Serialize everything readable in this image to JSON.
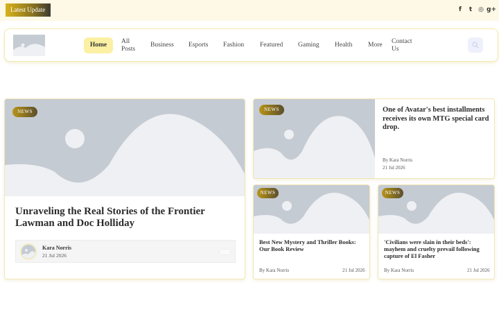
{
  "topbar": {
    "latest_label": "Latest Update",
    "social": [
      {
        "name": "facebook-icon",
        "glyph": "f"
      },
      {
        "name": "twitter-icon",
        "glyph": "t"
      },
      {
        "name": "instagram-icon",
        "glyph": "◎"
      },
      {
        "name": "google-plus-icon",
        "glyph": "g+"
      }
    ]
  },
  "nav": {
    "home": "Home",
    "all_posts_1": "All",
    "all_posts_2": "Posts",
    "business": "Business",
    "esports": "Esports",
    "fashion": "Fashion",
    "featured": "Featured",
    "gaming": "Gaming",
    "health": "Health",
    "more": "More",
    "contact_1": "Contact",
    "contact_2": "Us"
  },
  "colors": {
    "accent_yellow": "#fbf0a3",
    "badge_gold": "#b89416",
    "placeholder_gray": "#c5cbd3",
    "placeholder_light": "#eef0f3"
  },
  "featured": {
    "badge": "NEWS",
    "title": "Unraveling the Real Stories of the Frontier Lawman and Doc Holliday",
    "author": "Kara Norris",
    "date": "21 Jul 2026"
  },
  "side_top": {
    "badge": "NEWS",
    "title": "One of Avatar's best installments receives its own MTG special card drop.",
    "author": "By Kara Norris",
    "date": "21 Jul 2026"
  },
  "side_left": {
    "badge": "NEWS",
    "title": "Best New Mystery and Thriller Books: Our Book Review",
    "author": "By Kara Norris",
    "date": "21 Jul 2026"
  },
  "side_right": {
    "badge": "NEWS",
    "title": "'Civilians were slain in their beds': mayhem and cruelty prevail following capture of El Fasher",
    "author": "By Kara Norris",
    "date": "21 Jul 2026"
  }
}
